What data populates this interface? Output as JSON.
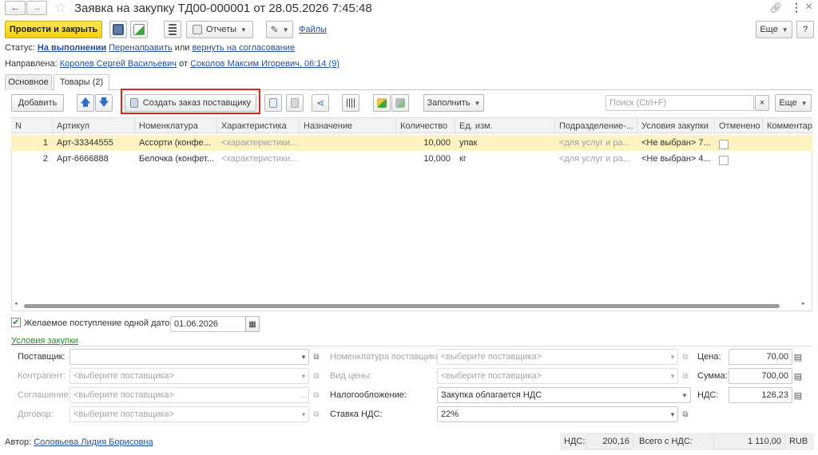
{
  "window": {
    "title": "Заявка на закупку ТД00-000001 от 28.05.2026 7:45:48"
  },
  "toolbar": {
    "post_close": "Провести и закрыть",
    "reports": "Отчеты",
    "files": "Файлы",
    "more": "Еще",
    "help": "?"
  },
  "status": {
    "label": "Статус:",
    "value": "На выполнении",
    "redirect": "Перенаправить",
    "or": "или",
    "return": "вернуть на согласование"
  },
  "directed": {
    "label": "Направлена:",
    "from_person": "Королев Сергей Васильевич",
    "from_word": "от",
    "to_person": "Соколов Максим Игоревич, 06:14 (9)"
  },
  "tabs": [
    {
      "label": "Основное"
    },
    {
      "label": "Товары (2)"
    }
  ],
  "table_toolbar": {
    "add": "Добавить",
    "create_order": "Создать заказ поставщику",
    "fill": "Заполнить",
    "search_placeholder": "Поиск (Ctrl+F)",
    "clear": "×",
    "more": "Еще"
  },
  "table": {
    "columns": [
      "N",
      "Артикул",
      "Номенклатура",
      "Характеристика",
      "Назначение",
      "Количество",
      "Ед. изм.",
      "Подразделение-...",
      "Условия закупки",
      "Отменено",
      "Комментарий"
    ],
    "rows": [
      {
        "n": "1",
        "article": "Арт-33344555",
        "nomenclature": "Ассорти (конфе...",
        "characteristic": "<характеристики...",
        "purpose": "",
        "quantity": "10,000",
        "unit": "упак",
        "department": "<для услуг и ра...",
        "conditions": "<Не выбран> 7...",
        "cancelled": false
      },
      {
        "n": "2",
        "article": "Арт-6666888",
        "nomenclature": "Белочка (конфет...",
        "characteristic": "<характеристики...",
        "purpose": "",
        "quantity": "10,000",
        "unit": "кг",
        "department": "<для услуг и ра...",
        "conditions": "<Не выбран> 4...",
        "cancelled": false
      }
    ]
  },
  "delivery": {
    "checked": true,
    "label": "Желаемое поступление одной датой",
    "date": "01.06.2026"
  },
  "conditions": {
    "header": "Условия закупки",
    "supplier_label": "Поставщик:",
    "supplier_value": "",
    "counterparty_label": "Контрагент:",
    "counterparty_value": "<выберите поставщика>",
    "agreement_label": "Соглашение:",
    "agreement_value": "<выберите поставщика>",
    "contract_label": "Договор:",
    "contract_value": "<выберите поставщика>",
    "supplier_nom_label": "Номенклатура поставщика:",
    "supplier_nom_value": "<выберите поставщика>",
    "price_type_label": "Вид цены:",
    "price_type_value": "<выберите поставщика>",
    "taxation_label": "Налогообложение:",
    "taxation_value": "Закупка облагается НДС",
    "vat_rate_label": "Ставка НДС:",
    "vat_rate_value": "22%",
    "price_label": "Цена:",
    "price_value": "70,00",
    "sum_label": "Сумма:",
    "sum_value": "700,00",
    "vat_label": "НДС:",
    "vat_value": "126,23"
  },
  "footer": {
    "author_label": "Автор:",
    "author_value": "Соловьева Лидия Борисовна",
    "vat_label": "НДС:",
    "vat_value": "200,16",
    "total_label": "Всего с НДС:",
    "total_value": "1 110,00",
    "currency": "RUB"
  },
  "colors": {
    "primary_button": "#f5d31a",
    "highlight": "#d9261c",
    "selected_row": "#fdf2c1",
    "link": "#1f4fa0"
  }
}
